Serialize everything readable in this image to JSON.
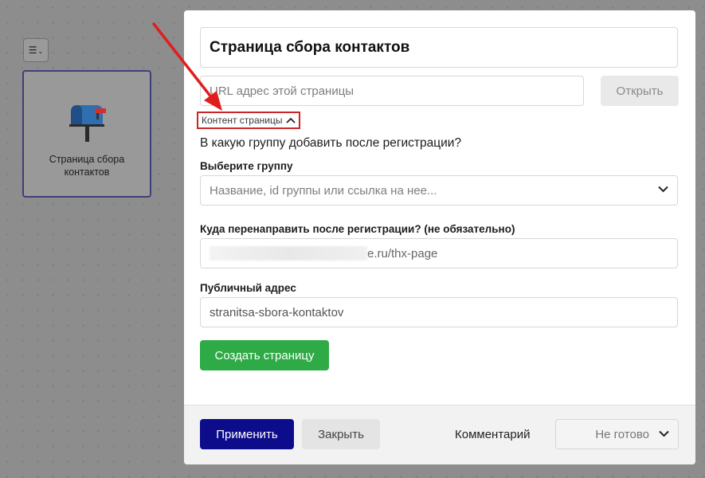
{
  "canvas": {
    "menu_icon": "menu-icon",
    "node": {
      "icon": "mailbox-icon",
      "label": "Страница сбора контактов"
    }
  },
  "modal": {
    "page_title": "Страница сбора контактов",
    "url_field": {
      "placeholder": "URL адрес этой страницы"
    },
    "open_label": "Открыть",
    "content_toggle_label": "Контент страницы",
    "group_question": "В какую группу добавить после регистрации?",
    "group_select": {
      "label": "Выберите группу",
      "placeholder": "Название, id группы или ссылка на нее..."
    },
    "redirect": {
      "label": "Куда перенаправить после регистрации? (не обязательно)",
      "value_visible": "e.ru/thx-page"
    },
    "public_address": {
      "label": "Публичный адрес",
      "value": "stranitsa-sbora-kontaktov"
    },
    "create_label": "Создать страницу"
  },
  "footer": {
    "apply_label": "Применить",
    "close_label": "Закрыть",
    "comment_label": "Комментарий",
    "status_value": "Не готово"
  },
  "colors": {
    "apply": "#0d0d8c",
    "create": "#2eaa46",
    "highlight": "#c62828",
    "annotation_arrow": "#e01e1e"
  }
}
